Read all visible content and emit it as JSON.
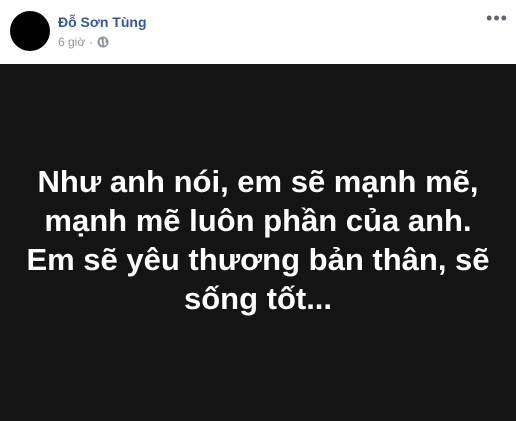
{
  "post": {
    "author": "Đỗ Sơn Tùng",
    "time": "6 giờ",
    "separator": "·",
    "privacy_icon": "globe-icon",
    "more_icon": "more-options-icon",
    "status_text": "Như anh nói, em sẽ mạnh mẽ, mạnh mẽ luôn phần của anh. Em sẽ yêu thương bản thân, sẽ sống tốt...",
    "colors": {
      "author": "#365899",
      "meta": "#90949c",
      "background": "#141414",
      "text": "#ffffff"
    }
  }
}
